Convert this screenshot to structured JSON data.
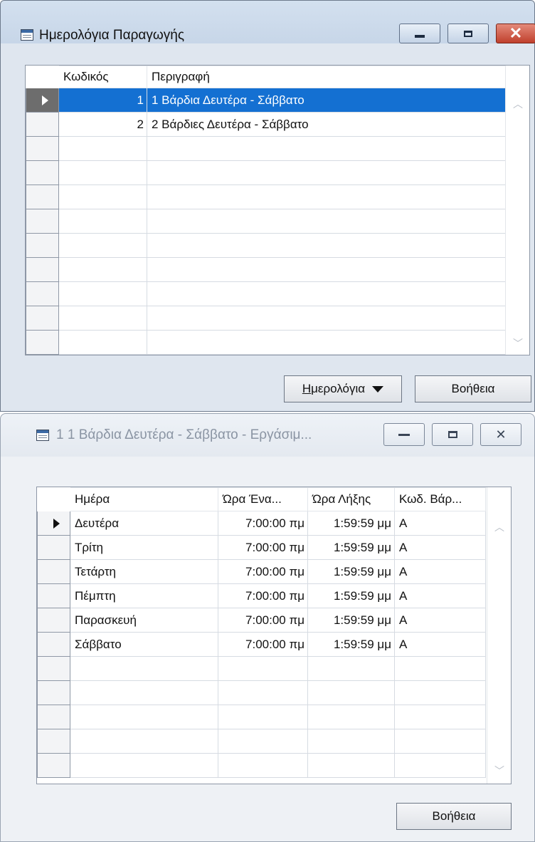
{
  "win1": {
    "title": "Ημερολόγια Παραγωγής",
    "grid": {
      "columns": [
        "Κωδικός",
        "Περιγραφή"
      ],
      "rows": [
        {
          "code": "1",
          "desc": "1 Βάρδια Δευτέρα - Σάββατο",
          "selected": true
        },
        {
          "code": "2",
          "desc": "2 Βάρδιες Δευτέρα - Σάββατο",
          "selected": false
        }
      ]
    },
    "buttons": {
      "calendars_first": "Η",
      "calendars_rest": "μερολόγια",
      "help": "Βοήθεια"
    }
  },
  "win2": {
    "title": "1 1 Βάρδια Δευτέρα - Σάββατο - Εργάσιμ...",
    "grid": {
      "columns": [
        "Ημέρα",
        "Ώρα Ένα...",
        "Ώρα Λήξης",
        "Κωδ. Βάρ..."
      ],
      "rows": [
        {
          "day": "Δευτέρα",
          "start": "7:00:00 πμ",
          "end": "1:59:59 μμ",
          "shift": "Α"
        },
        {
          "day": "Τρίτη",
          "start": "7:00:00 πμ",
          "end": "1:59:59 μμ",
          "shift": "Α"
        },
        {
          "day": "Τετάρτη",
          "start": "7:00:00 πμ",
          "end": "1:59:59 μμ",
          "shift": "Α"
        },
        {
          "day": "Πέμπτη",
          "start": "7:00:00 πμ",
          "end": "1:59:59 μμ",
          "shift": "Α"
        },
        {
          "day": "Παρασκευή",
          "start": "7:00:00 πμ",
          "end": "1:59:59 μμ",
          "shift": "Α"
        },
        {
          "day": "Σάββατο",
          "start": "7:00:00 πμ",
          "end": "1:59:59 μμ",
          "shift": "Α"
        }
      ]
    },
    "buttons": {
      "help": "Βοήθεια"
    }
  },
  "icons": [
    "table-window-icon",
    "minimize-icon",
    "maximize-icon",
    "close-icon",
    "row-pointer-icon",
    "scroll-up-icon",
    "scroll-down-icon",
    "dropdown-arrow-icon"
  ],
  "colors": {
    "selection": "#1470d2",
    "close_button": "#c0402c",
    "title_active": "#c7d6e8"
  }
}
